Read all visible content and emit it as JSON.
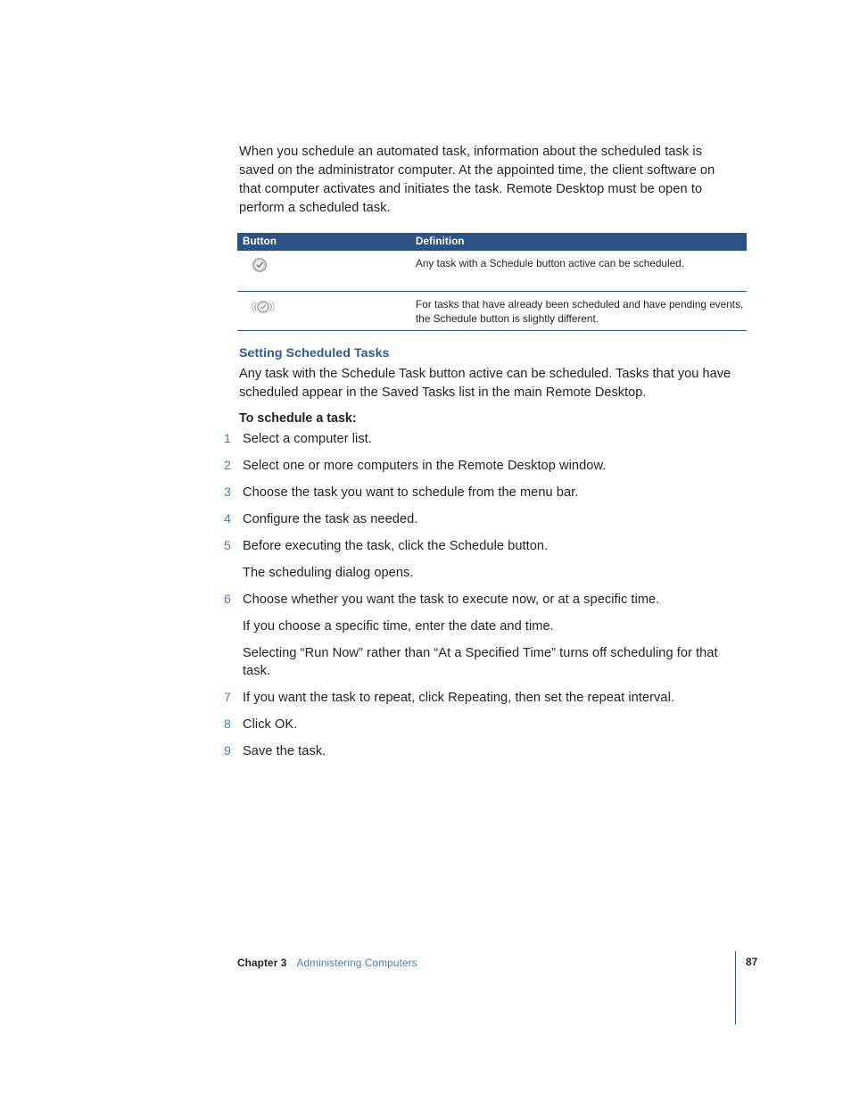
{
  "page": {
    "intro": "When you schedule an automated task, information about the scheduled task is saved on the administrator computer. At the appointed time, the client software on that computer activates and initiates the task. Remote Desktop must be open to perform a scheduled task."
  },
  "table": {
    "headers": {
      "button": "Button",
      "definition": "Definition"
    },
    "rows": [
      {
        "icon": "schedule-clock-icon",
        "definition": "Any task with a Schedule button active can be scheduled."
      },
      {
        "icon": "schedule-pending-alarm-clock-icon",
        "definition": "For tasks that have already been scheduled and have pending events, the Schedule button is slightly different."
      }
    ]
  },
  "section": {
    "heading": "Setting Scheduled Tasks",
    "body": "Any task with the Schedule Task button active can be scheduled. Tasks that you have scheduled appear in the Saved Tasks list in the main Remote Desktop.",
    "subheading": "To schedule a task:"
  },
  "steps": [
    {
      "num": "1",
      "text": "Select a computer list."
    },
    {
      "num": "2",
      "text": "Select one or more computers in the Remote Desktop window."
    },
    {
      "num": "3",
      "text": "Choose the task you want to schedule from the menu bar."
    },
    {
      "num": "4",
      "text": "Configure the task as needed."
    },
    {
      "num": "5",
      "text": "Before executing the task, click the Schedule button."
    }
  ],
  "after_step5": "The scheduling dialog opens.",
  "step6": {
    "num": "6",
    "text": "Choose whether you want the task to execute now, or at a specific time."
  },
  "after_step6_a": "If you choose a specific time, enter the date and time.",
  "after_step6_b": "Selecting “Run Now” rather than “At a Specified Time” turns off scheduling for that task.",
  "steps_tail": [
    {
      "num": "7",
      "text": "If you want the task to repeat, click Repeating, then set the repeat interval."
    },
    {
      "num": "8",
      "text": "Click OK."
    },
    {
      "num": "9",
      "text": "Save the task."
    }
  ],
  "footer": {
    "chapter": "Chapter 3",
    "title": "Administering Computers",
    "page_number": "87"
  },
  "colors": {
    "table_header_bg": "#2d5385",
    "heading_blue": "#2b5b96",
    "accent_blue": "#4a7ab5",
    "text": "#231f20"
  }
}
